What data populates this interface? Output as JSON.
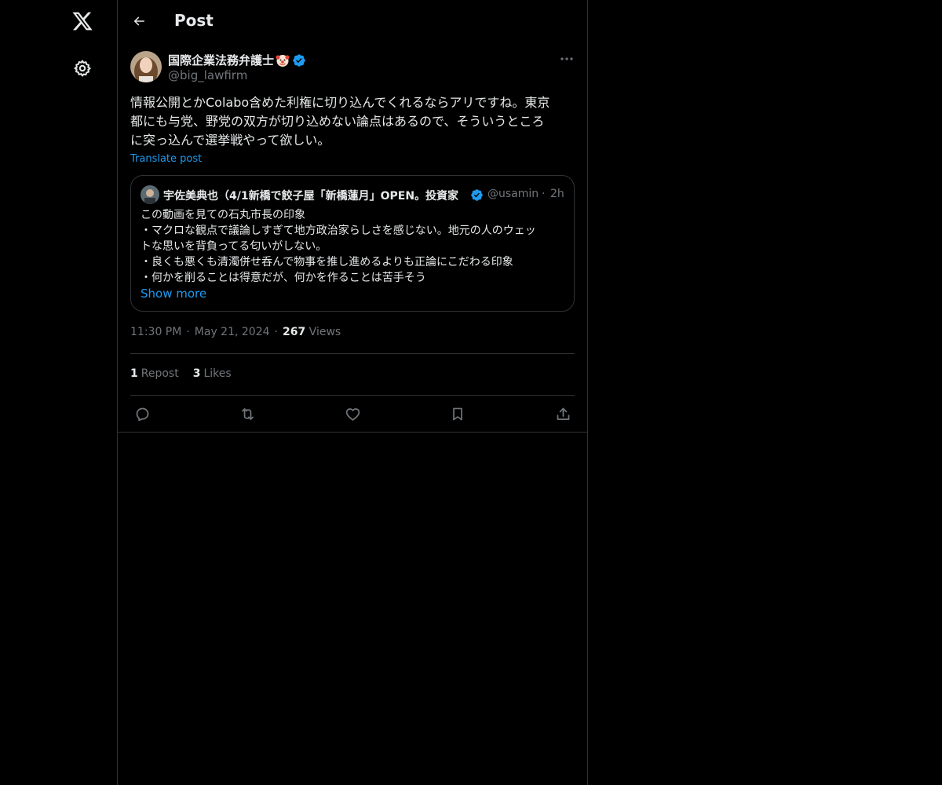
{
  "nav": {
    "logo_icon": "x-logo-icon",
    "settings_icon": "gear-icon"
  },
  "header": {
    "title": "Post",
    "back_icon": "arrow-left-icon"
  },
  "post": {
    "author_name": "国際企業法務弁護士",
    "author_emoji": "clown-face-icon",
    "author_handle": "@big_lawfirm",
    "verified_icon": "verified-badge-icon",
    "text": "情報公開とかColabo含めた利権に切り込んでくれるならアリですね。東京\n都にも与党、野党の双方が切り込めない論点はあるので、そういうところ\nに突っ込んで選挙戦やって欲しい。",
    "translate_label": "Translate post",
    "time": "11:30 PM",
    "date": "May 21, 2024",
    "views_count": "267",
    "views_label": "Views",
    "repost_count": "1",
    "repost_label": "Repost",
    "likes_count": "3",
    "likes_label": "Likes"
  },
  "quote": {
    "author_name": "宇佐美典也（4/1新橋で餃子屋「新橋蓮月」OPEN。投資家",
    "author_handle": "@usamin",
    "separator": "·",
    "time": "2h",
    "lines": [
      "この動画を見ての石丸市長の印象",
      "・マクロな観点で議論しすぎて地方政治家らしさを感じない。地元の人のウェッ",
      "トな思いを背負ってる匂いがしない。",
      "・良くも悪くも清濁併せ呑んで物事を推し進めるよりも正論にこだわる印象",
      "・何かを削ることは得意だが、何かを作ることは苦手そう"
    ],
    "show_more": "Show more"
  },
  "actions": [
    "reply-icon",
    "repost-icon",
    "like-icon",
    "bookmark-icon",
    "share-icon"
  ],
  "colors": {
    "background": "#000000",
    "text": "#e7e9ea",
    "secondary": "#71767b",
    "accent": "#1d9bf0",
    "border": "#2f3336"
  }
}
